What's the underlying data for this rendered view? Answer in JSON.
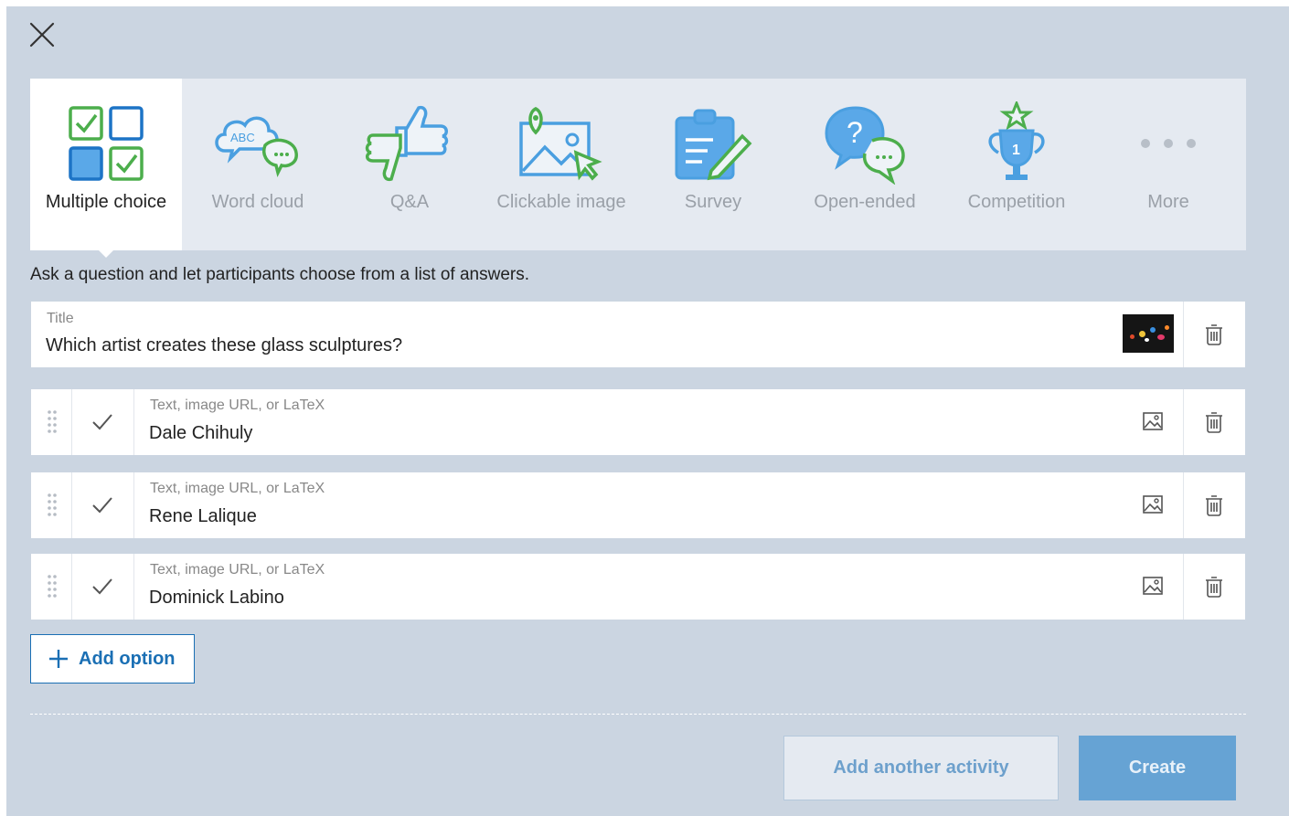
{
  "modal": {
    "close_icon": "close-icon"
  },
  "tabs": [
    {
      "label": "Multiple choice",
      "icon": "multiple-choice-icon",
      "active": true
    },
    {
      "label": "Word cloud",
      "icon": "word-cloud-icon"
    },
    {
      "label": "Q&A",
      "icon": "thumbs-up-down-icon"
    },
    {
      "label": "Clickable image",
      "icon": "clickable-image-icon"
    },
    {
      "label": "Survey",
      "icon": "survey-clipboard-icon"
    },
    {
      "label": "Open-ended",
      "icon": "open-ended-bubbles-icon"
    },
    {
      "label": "Competition",
      "icon": "trophy-icon"
    },
    {
      "label": "More",
      "icon": "more-dots-icon"
    }
  ],
  "description": "Ask a question and let participants choose from a list of answers.",
  "title_field": {
    "label": "Title",
    "value": "Which artist creates these glass sculptures?"
  },
  "options": [
    {
      "placeholder": "Text, image URL, or LaTeX",
      "value": "Dale Chihuly"
    },
    {
      "placeholder": "Text, image URL, or LaTeX",
      "value": "Rene Lalique"
    },
    {
      "placeholder": "Text, image URL, or LaTeX",
      "value": "Dominick Labino"
    }
  ],
  "add_option_label": "Add option",
  "footer": {
    "add_another_label": "Add another activity",
    "create_label": "Create"
  },
  "colors": {
    "accent_blue": "#1a6fb4",
    "icon_blue": "#4a9fe0",
    "icon_green": "#4cae4c",
    "backdrop": "#cbd5e1",
    "create_button": "#66a3d4"
  }
}
